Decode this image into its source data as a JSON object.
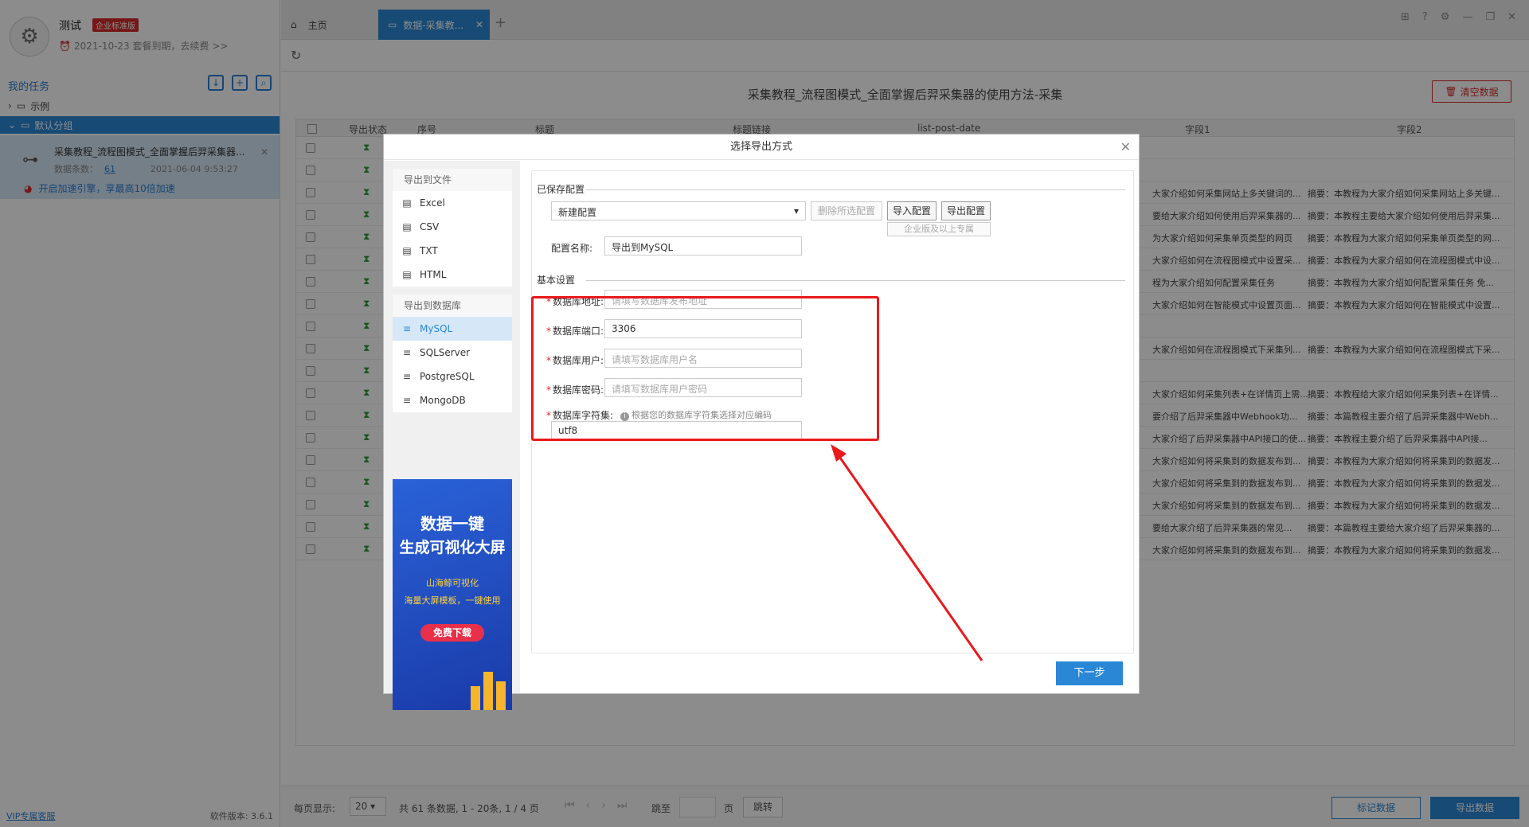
{
  "sidebar": {
    "username": "测试",
    "edition_badge": "企业标准版",
    "expire_text": "2021-10-23 套餐到期，去续费 >>",
    "my_tasks": "我的任务",
    "folders": [
      "示例",
      "默认分组"
    ],
    "task": {
      "title": "采集教程_流程图模式_全面掌握后羿采集器...",
      "count_label": "数据条数：",
      "count": "61",
      "date": "2021-06-04 9:53:27",
      "boost": "开启加速引擎，享最高10倍加速"
    },
    "footer": {
      "vip": "VIP专属客服",
      "version": "软件版本: 3.6.1"
    }
  },
  "tabs": {
    "home": "主页",
    "active": "数据-采集教...",
    "add": "+"
  },
  "page": {
    "task_name": "采集教程_流程图模式_全面掌握后羿采集器的使用方法-采集",
    "clear_button": "清空数据"
  },
  "grid": {
    "headers": [
      "导出状态",
      "序号",
      "标题",
      "标题链接",
      "list-post-date",
      "字段1",
      "字段2"
    ],
    "rows": [
      {
        "c1": "",
        "c2": ""
      },
      {
        "c1": "",
        "c2": ""
      },
      {
        "c1": "大家介绍如何采集网站上多关键词的...",
        "c2": "摘要：本教程为大家介绍如何采集网站上多关键..."
      },
      {
        "c1": "要给大家介绍如何使用后羿采集器的...",
        "c2": "摘要：本教程主要给大家介绍如何使用后羿采集..."
      },
      {
        "c1": "为大家介绍如何采集单页类型的网页",
        "c2": "摘要：本教程为大家介绍如何采集单页类型的网..."
      },
      {
        "c1": "大家介绍如何在流程图模式中设置采...",
        "c2": "摘要：本教程为大家介绍如何在流程图模式中设..."
      },
      {
        "c1": "程为大家介绍如何配置采集任务",
        "c2": "摘要：本教程为大家介绍如何配置采集任务 免..."
      },
      {
        "c1": "大家介绍如何在智能模式中设置页面...",
        "c2": "摘要：本教程为大家介绍如何在智能模式中设置..."
      },
      {
        "c1": "",
        "c2": ""
      },
      {
        "c1": "大家介绍如何在流程图模式下采集列...",
        "c2": "摘要：本教程为大家介绍如何在流程图模式下采..."
      },
      {
        "c1": "",
        "c2": ""
      },
      {
        "c1": "大家介绍如何采集列表+在详情页上需...",
        "c2": "摘要：本教程给大家介绍如何采集列表+在详情..."
      },
      {
        "c1": "要介绍了后羿采集器中Webhook功...",
        "c2": "摘要：本篇教程主要介绍了后羿采集器中Webh..."
      },
      {
        "c1": "大家介绍了后羿采集器中API接口的使...",
        "c2": "摘要：本教程主要介绍了后羿采集器中API接..."
      },
      {
        "c1": "大家介绍如何将采集到的数据发布到...",
        "c2": "摘要：本教程为大家介绍如何将采集到的数据发..."
      },
      {
        "c1": "大家介绍如何将采集到的数据发布到...",
        "c2": "摘要：本教程为大家介绍如何将采集到的数据发..."
      },
      {
        "c1": "大家介绍如何将采集到的数据发布到...",
        "c2": "摘要：本教程为大家介绍如何将采集到的数据发..."
      },
      {
        "c1": "要给大家介绍了后羿采集器的常见...",
        "c2": "摘要：本篇教程主要给大家介绍了后羿采集器的..."
      },
      {
        "c1": "大家介绍如何将采集到的数据发布到...",
        "c2": "摘要：本教程为大家介绍如何将采集到的数据发..."
      }
    ]
  },
  "bottom": {
    "per_page_label": "每页显示:",
    "per_page": "20 ▾",
    "info": "共 61 条数据, 1 - 20条, 1 / 4 页",
    "jump_label": "跳至",
    "page_label": "页",
    "go": "跳转",
    "mark": "标记数据",
    "export": "导出数据"
  },
  "dialog": {
    "title": "选择导出方式",
    "file_group": "导出到文件",
    "file_options": [
      "Excel",
      "CSV",
      "TXT",
      "HTML"
    ],
    "db_group": "导出到数据库",
    "db_options": [
      "MySQL",
      "SQLServer",
      "PostgreSQL",
      "MongoDB"
    ],
    "promo": {
      "line1": "数据一键",
      "line2": "生成可视化大屏",
      "line3": "山海鲸可视化",
      "line4": "海量大屏模板，一键使用",
      "cta": "免费下载"
    },
    "saved_config": "已保存配置",
    "config_select": "新建配置",
    "delete_config": "删除所选配置",
    "import_config": "导入配置",
    "export_config": "导出配置",
    "enterprise_note": "企业版及以上专属",
    "config_name_label": "配置名称:",
    "config_name": "导出到MySQL",
    "basic": "基本设置",
    "db_address_label": "数据库地址:",
    "db_address_ph": "请填写数据库发布地址",
    "db_port_label": "数据库端口:",
    "db_port": "3306",
    "db_user_label": "数据库用户:",
    "db_user_ph": "请填写数据库用户名",
    "db_pass_label": "数据库密码:",
    "db_pass_ph": "请填写数据库用户密码",
    "charset_label": "数据库字符集:",
    "charset_hint": "根据您的数据库字符集选择对应编码",
    "charset": "utf8",
    "next": "下一步"
  },
  "colors": {
    "accent": "#2a87d6",
    "highlight": "#e8191c"
  }
}
